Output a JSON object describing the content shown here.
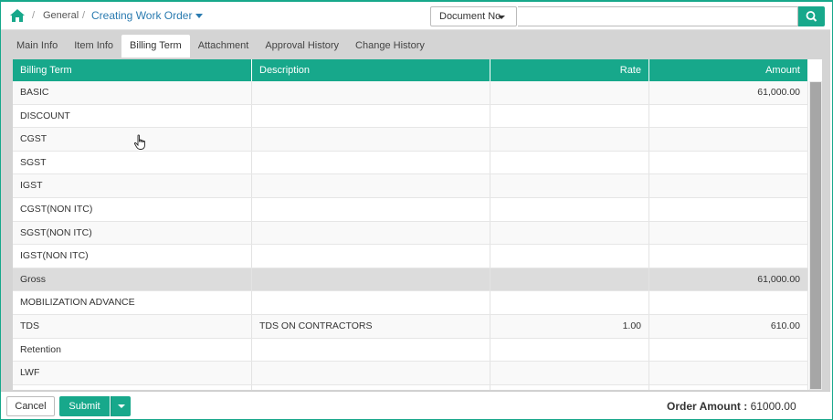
{
  "breadcrumb": {
    "home_icon": "home-icon",
    "items": [
      "General",
      "Creating Work Order"
    ]
  },
  "search": {
    "field_select": "Document No",
    "placeholder": "",
    "button_icon": "search-icon"
  },
  "tabs": [
    {
      "label": "Main Info",
      "active": false
    },
    {
      "label": "Item Info",
      "active": false
    },
    {
      "label": "Billing Term",
      "active": true
    },
    {
      "label": "Attachment",
      "active": false
    },
    {
      "label": "Approval History",
      "active": false
    },
    {
      "label": "Change History",
      "active": false
    }
  ],
  "table": {
    "columns": [
      "Billing Term",
      "Description",
      "Rate",
      "Amount"
    ],
    "rows": [
      [
        "BASIC",
        "",
        "",
        "61,000.00"
      ],
      [
        "DISCOUNT",
        "",
        "",
        ""
      ],
      [
        "CGST",
        "",
        "",
        ""
      ],
      [
        "SGST",
        "",
        "",
        ""
      ],
      [
        "IGST",
        "",
        "",
        ""
      ],
      [
        "CGST(NON ITC)",
        "",
        "",
        ""
      ],
      [
        "SGST(NON ITC)",
        "",
        "",
        ""
      ],
      [
        "IGST(NON ITC)",
        "",
        "",
        ""
      ],
      [
        "Gross",
        "",
        "",
        "61,000.00"
      ],
      [
        "MOBILIZATION ADVANCE",
        "",
        "",
        ""
      ],
      [
        "TDS",
        "TDS ON CONTRACTORS",
        "1.00",
        "610.00"
      ],
      [
        "Retention",
        "",
        "",
        ""
      ],
      [
        "LWF",
        "",
        "",
        ""
      ],
      [
        "",
        "",
        "",
        ""
      ]
    ]
  },
  "footer": {
    "cancel_label": "Cancel",
    "submit_label": "Submit",
    "order_amount_label": "Order Amount :",
    "order_amount_value": "61000.00"
  },
  "colors": {
    "accent": "#17a88b",
    "link": "#2a7bb0"
  }
}
